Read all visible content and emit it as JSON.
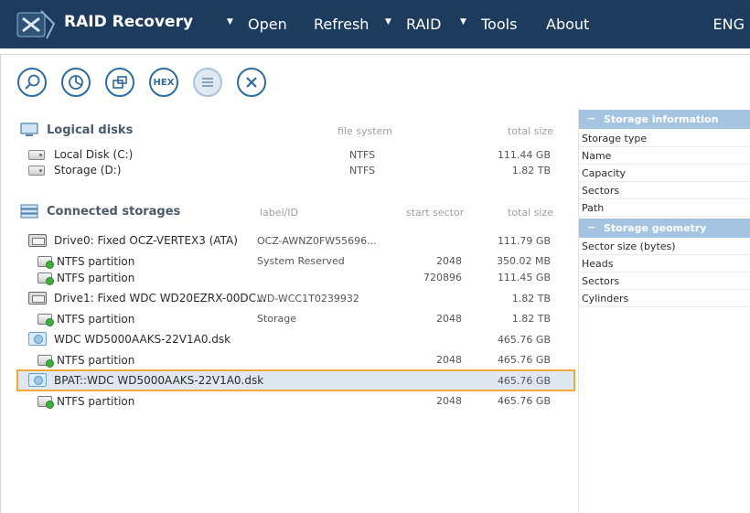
{
  "app": {
    "title": "RAID Recovery",
    "menu": [
      "Open",
      "Refresh",
      "RAID",
      "Tools",
      "About"
    ],
    "language": "ENG"
  },
  "toolbar": {
    "hex_label": "HEX"
  },
  "logical_disks": {
    "title": "Logical disks",
    "col_fs": "file system",
    "col_size": "total size",
    "items": [
      {
        "name": "Local Disk (C:)",
        "fs": "NTFS",
        "size": "111.44 GB"
      },
      {
        "name": "Storage (D:)",
        "fs": "NTFS",
        "size": "1.82 TB"
      }
    ]
  },
  "connected": {
    "title": "Connected storages",
    "col_label": "label/ID",
    "col_start": "start sector",
    "col_size": "total size",
    "rows": [
      {
        "name": "Drive0: Fixed OCZ-VERTEX3 (ATA)",
        "label": "OCZ-AWNZ0FW55696...",
        "start": "",
        "size": "111.79 GB"
      },
      {
        "name": "NTFS partition",
        "label": "System Reserved",
        "start": "2048",
        "size": "350.02 MB"
      },
      {
        "name": "NTFS partition",
        "label": "",
        "start": "720896",
        "size": "111.45 GB"
      },
      {
        "name": "Drive1: Fixed WDC WD20EZRX-00DC...",
        "label": "WD-WCC1T0239932",
        "start": "",
        "size": "1.82 TB"
      },
      {
        "name": "NTFS partition",
        "label": "Storage",
        "start": "2048",
        "size": "1.82 TB"
      },
      {
        "name": "WDC WD5000AAKS-22V1A0.dsk",
        "label": "",
        "start": "",
        "size": "465.76 GB"
      },
      {
        "name": "NTFS partition",
        "label": "",
        "start": "2048",
        "size": "465.76 GB"
      },
      {
        "name": "BPAT::WDC WD5000AAKS-22V1A0.dsk",
        "label": "",
        "start": "",
        "size": "465.76 GB"
      },
      {
        "name": "NTFS partition",
        "label": "",
        "start": "2048",
        "size": "465.76 GB"
      }
    ]
  },
  "storage_info": {
    "title": "Storage information",
    "fields": [
      "Storage type",
      "Name",
      "Capacity",
      "Sectors",
      "Path"
    ]
  },
  "storage_geometry": {
    "title": "Storage geometry",
    "fields": [
      "Sector size (bytes)",
      "Heads",
      "Sectors",
      "Cylinders"
    ]
  },
  "colors": {
    "titlebar": "#1d3b5c",
    "accent": "#2f6b9e",
    "selection_border": "#f0a83a",
    "panel_header": "#a5c4e2"
  }
}
